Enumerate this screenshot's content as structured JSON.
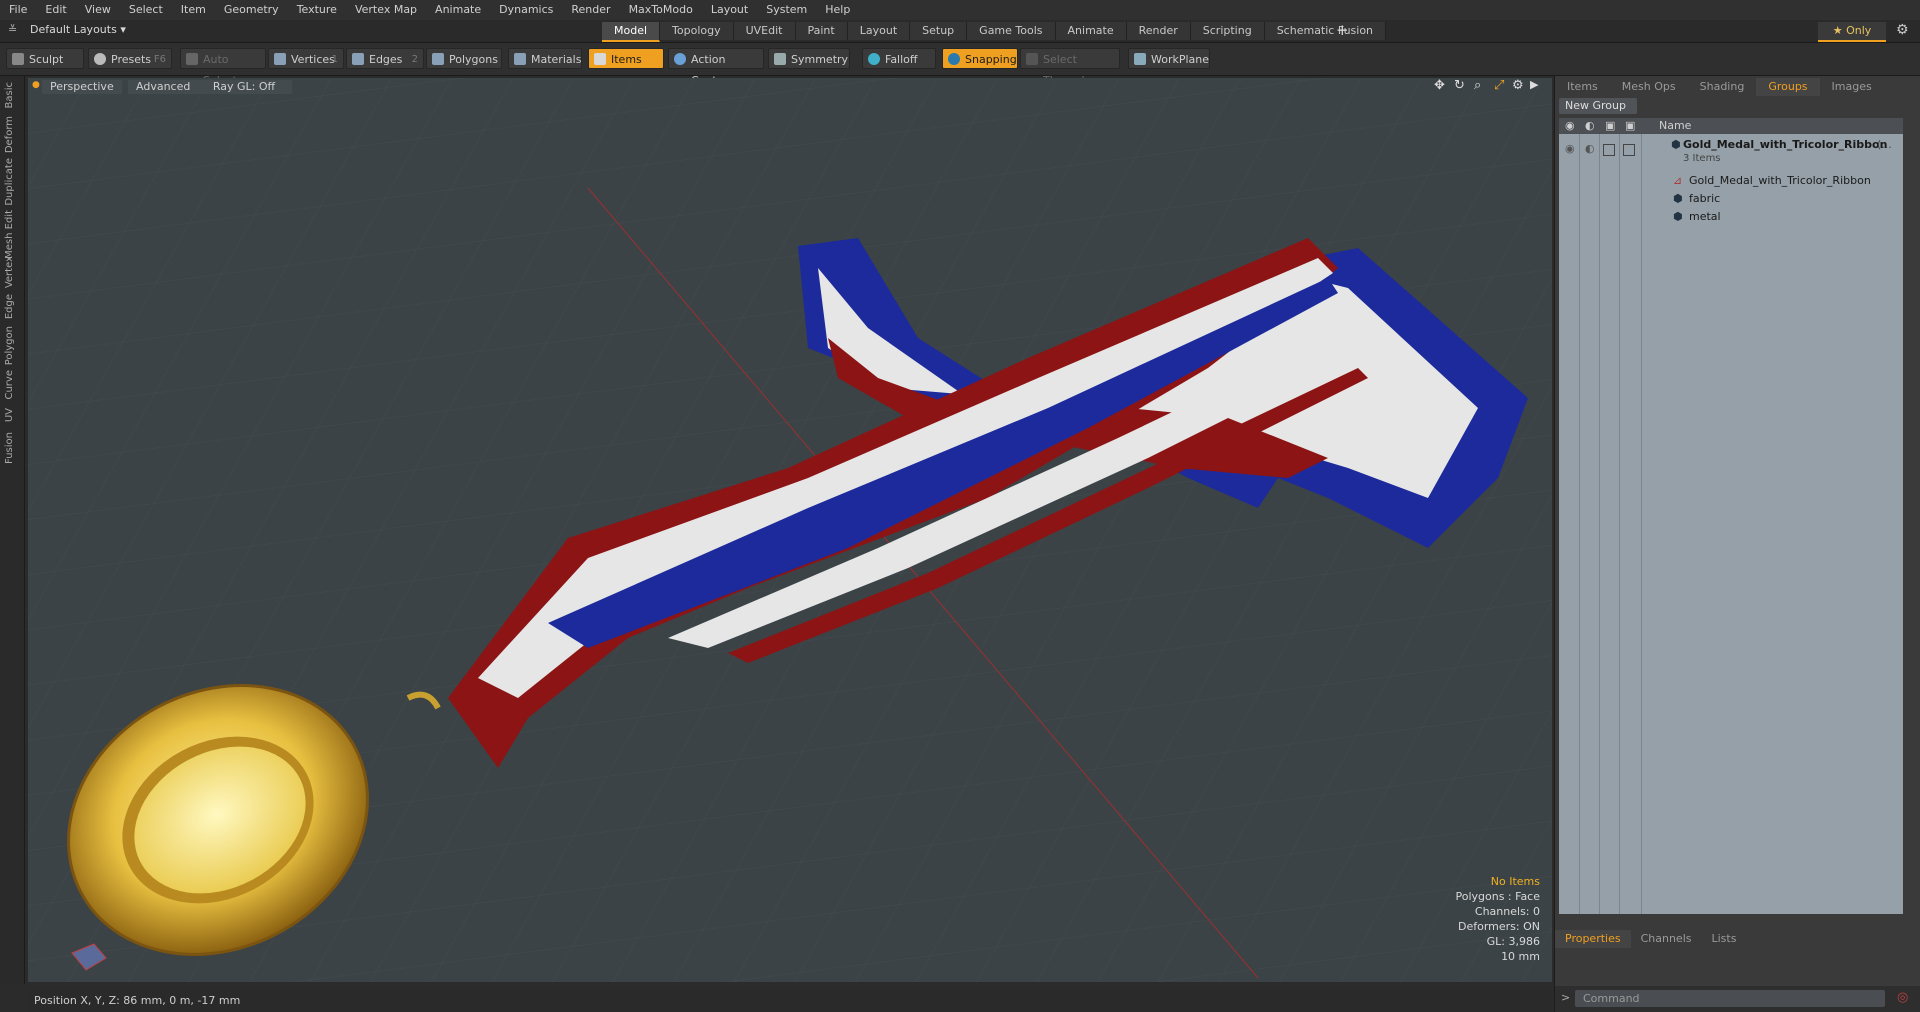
{
  "menu": [
    "File",
    "Edit",
    "View",
    "Select",
    "Item",
    "Geometry",
    "Texture",
    "Vertex Map",
    "Animate",
    "Dynamics",
    "Render",
    "MaxToModo",
    "Layout",
    "System",
    "Help"
  ],
  "layout_dropdown": "Default Layouts",
  "tabs": [
    "Model",
    "Topology",
    "UVEdit",
    "Paint",
    "Layout",
    "Setup",
    "Game Tools",
    "Animate",
    "Render",
    "Scripting",
    "Schematic Fusion"
  ],
  "active_tab": "Model",
  "only_label": "Only",
  "toolbar": {
    "sculpt": "Sculpt",
    "presets": "Presets",
    "presets_key": "F6",
    "auto_select": "Auto Select",
    "vertices": "Vertices",
    "vertices_key": "1",
    "edges": "Edges",
    "edges_key": "2",
    "polygons": "Polygons",
    "materials": "Materials",
    "items": "Items",
    "action_center": "Action Center",
    "symmetry": "Symmetry",
    "falloff": "Falloff",
    "snapping": "Snapping",
    "select_through": "Select Through",
    "workplane": "WorkPlane"
  },
  "left_tabs": [
    "Basic",
    "Deform",
    "Duplicate",
    "Mesh Edit",
    "Vertex",
    "Edge",
    "Polygon",
    "Curve",
    "UV",
    "Fusion"
  ],
  "viewport": {
    "view": "Perspective",
    "mode": "Advanced",
    "raygl": "Ray GL: Off",
    "info": {
      "items": "No Items",
      "polygons": "Polygons : Face",
      "channels": "Channels: 0",
      "deformers": "Deformers: ON",
      "gl": "GL: 3,986",
      "scale": "10 mm"
    }
  },
  "status": "Position X, Y, Z:   86 mm, 0 m, -17 mm",
  "right_panel": {
    "tabs": [
      "Items",
      "Mesh Ops",
      "Shading",
      "Groups",
      "Images"
    ],
    "active_tab": "Groups",
    "new_group": "New Group",
    "name_header": "Name",
    "group_name": "Gold_Medal_with_Tricolor_Ribbon",
    "group_name_suffix": "(...",
    "group_count": "3 Items",
    "children": [
      "Gold_Medal_with_Tricolor_Ribbon",
      "fabric",
      "metal"
    ],
    "bottom_tabs": [
      "Properties",
      "Channels",
      "Lists"
    ],
    "active_bottom_tab": "Properties",
    "command_placeholder": "Command"
  },
  "colors": {
    "accent": "#f0a020",
    "ribbon_red": "#8c1414",
    "ribbon_blue": "#1c2a9c",
    "ribbon_white": "#e6e6e6",
    "gold": "#e8c040"
  }
}
